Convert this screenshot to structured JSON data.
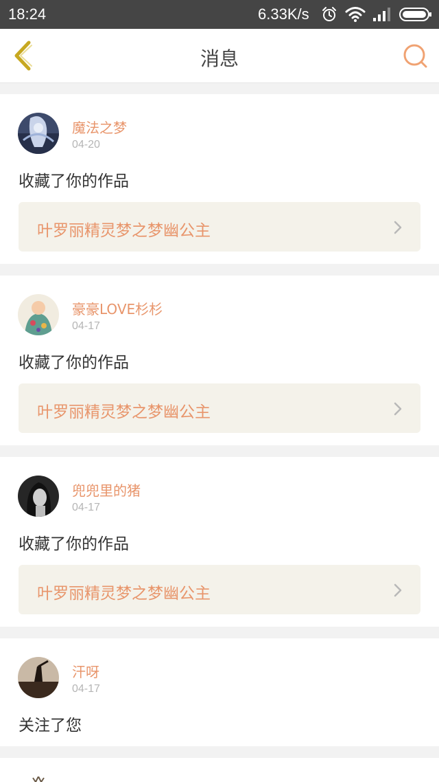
{
  "status_bar": {
    "time": "18:24",
    "network_speed": "6.33K/s",
    "icons": [
      "alarm-icon",
      "wifi-icon",
      "signal-icon",
      "battery-icon"
    ]
  },
  "nav": {
    "title": "消息",
    "back_icon": "back-chevron-icon",
    "search_icon": "search-icon"
  },
  "colors": {
    "accent": "#e8956b",
    "back_icon": "#c7a820",
    "search_icon": "#f0a272",
    "status_bar": "#454545",
    "link_box": "#f4f2ea",
    "page_bg": "#f2f2f2"
  },
  "messages": [
    {
      "username": "魔法之梦",
      "date": "04-20",
      "action": "收藏了你的作品",
      "work_title": "叶罗丽精灵梦之梦幽公主"
    },
    {
      "username": "豪豪LOVE杉杉",
      "date": "04-17",
      "action": "收藏了你的作品",
      "work_title": "叶罗丽精灵梦之梦幽公主"
    },
    {
      "username": "兜兜里的猪",
      "date": "04-17",
      "action": "收藏了你的作品",
      "work_title": "叶罗丽精灵梦之梦幽公主"
    },
    {
      "username": "汗呀",
      "date": "04-17",
      "action": "关注了您"
    }
  ]
}
